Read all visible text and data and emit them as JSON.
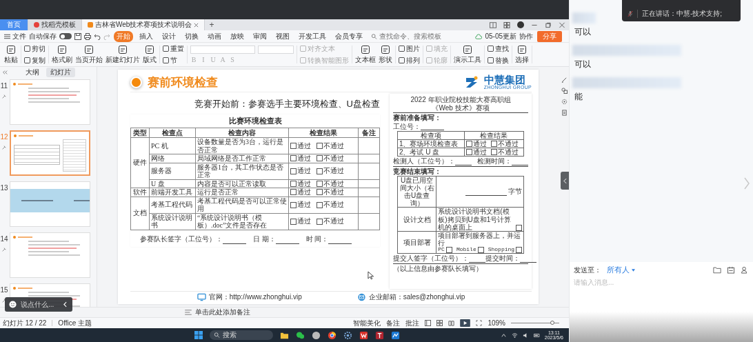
{
  "window": {
    "tabs": [
      {
        "label": "首页",
        "kind": "home",
        "selected": false
      },
      {
        "label": "找稻壳模板",
        "kind": "template",
        "selected": false
      },
      {
        "label": "吉林省Web技术赛项技术说明会",
        "kind": "document",
        "selected": true
      }
    ],
    "new_tab": "+"
  },
  "menu": {
    "file": "文件",
    "autosave": {
      "label": "自动保存",
      "on": false
    },
    "items": [
      {
        "label": "开始",
        "selected": true
      },
      {
        "label": "插入",
        "selected": false
      },
      {
        "label": "设计",
        "selected": false
      },
      {
        "label": "切换",
        "selected": false
      },
      {
        "label": "动画",
        "selected": false
      },
      {
        "label": "放映",
        "selected": false
      },
      {
        "label": "审阅",
        "selected": false
      },
      {
        "label": "视图",
        "selected": false
      },
      {
        "label": "开发工具",
        "selected": false
      },
      {
        "label": "会员专享",
        "selected": false
      }
    ],
    "search": {
      "placeholder": "查找命令、搜索模板"
    },
    "update": "05-05更新",
    "collab": "协作",
    "share": "分享"
  },
  "ribbon": {
    "groups": [
      {
        "kind": "large",
        "items": [
          {
            "label": "粘贴",
            "disabled": false
          }
        ]
      },
      {
        "kind": "stack",
        "items": [
          {
            "label": "剪切",
            "disabled": false
          },
          {
            "label": "复制",
            "disabled": false
          }
        ]
      },
      {
        "kind": "large",
        "items": [
          {
            "label": "格式刷",
            "disabled": false
          },
          {
            "label": "当页开始",
            "disabled": false
          },
          {
            "label": "新建幻灯片",
            "disabled": false
          },
          {
            "label": "版式",
            "disabled": false
          }
        ]
      },
      {
        "kind": "stack",
        "items": [
          {
            "label": "重置",
            "disabled": false
          },
          {
            "label": "节",
            "disabled": false
          }
        ]
      },
      {
        "kind": "font",
        "items": [
          {
            "label": "B",
            "disabled": true
          },
          {
            "label": "I",
            "disabled": true
          },
          {
            "label": "U",
            "disabled": true
          },
          {
            "label": "A",
            "disabled": true
          },
          {
            "label": "S",
            "disabled": true
          }
        ]
      },
      {
        "kind": "stack",
        "items": [
          {
            "label": "对齐文本",
            "disabled": true
          },
          {
            "label": "转换智能图形",
            "disabled": true
          }
        ]
      },
      {
        "kind": "large",
        "items": [
          {
            "label": "文本框",
            "disabled": false
          },
          {
            "label": "形状",
            "disabled": false
          }
        ]
      },
      {
        "kind": "stack",
        "items": [
          {
            "label": "图片",
            "disabled": false
          },
          {
            "label": "排列",
            "disabled": false
          }
        ]
      },
      {
        "kind": "stack",
        "items": [
          {
            "label": "填充",
            "disabled": true
          },
          {
            "label": "轮廓",
            "disabled": true
          }
        ]
      },
      {
        "kind": "large",
        "items": [
          {
            "label": "演示工具",
            "disabled": false
          }
        ]
      },
      {
        "kind": "stack",
        "items": [
          {
            "label": "查找",
            "disabled": false
          },
          {
            "label": "替换",
            "disabled": false
          }
        ]
      },
      {
        "kind": "large",
        "items": [
          {
            "label": "选择",
            "disabled": false
          }
        ]
      }
    ]
  },
  "slides_panel": {
    "tabs": [
      {
        "label": "大纲",
        "selected": false
      },
      {
        "label": "幻灯片",
        "selected": true
      }
    ],
    "thumbnails": [
      {
        "number": "11",
        "kind": "text",
        "selected": false,
        "animated": true
      },
      {
        "number": "12",
        "kind": "table",
        "selected": true,
        "animated": true
      },
      {
        "number": "13",
        "kind": "section",
        "selected": false,
        "animated": false
      },
      {
        "number": "14",
        "kind": "text",
        "selected": false,
        "animated": true
      },
      {
        "number": "15",
        "kind": "text",
        "selected": false,
        "animated": true
      }
    ]
  },
  "slide": {
    "title": "赛前环境检查",
    "logo": {
      "name": "中慧集团",
      "subtitle": "ZHONGHUI GROUP"
    },
    "subtitle": "竞赛开始前：参赛选手主要环境检查、U盘检查",
    "check_table": {
      "title": "比赛环境检查表",
      "columns": [
        "类型",
        "检查点",
        "检查内容",
        "检查结果",
        "备注"
      ],
      "groups": [
        {
          "type": "硬件",
          "rows": [
            {
              "point": "PC 机",
              "content": "设备数量是否为3台，运行是否正常",
              "results": [
                {
                  "label": "通过",
                  "checked": false
                },
                {
                  "label": "不通过",
                  "checked": false
                }
              ]
            },
            {
              "point": "网络",
              "content": "局域网络是否工作正常",
              "results": [
                {
                  "label": "通过",
                  "checked": false
                },
                {
                  "label": "不通过",
                  "checked": false
                }
              ]
            },
            {
              "point": "服务器",
              "content": "服务器1台，其工作状态是否正常",
              "results": [
                {
                  "label": "通过",
                  "checked": false
                },
                {
                  "label": "不通过",
                  "checked": false
                }
              ]
            },
            {
              "point": "U 盘",
              "content": "内容是否可以正常读取",
              "results": [
                {
                  "label": "通过",
                  "checked": false
                },
                {
                  "label": "不通过",
                  "checked": false
                }
              ]
            }
          ]
        },
        {
          "type": "软件",
          "rows": [
            {
              "point": "前端开发工具",
              "content": "运行是否正常",
              "results": [
                {
                  "label": "通过",
                  "checked": false
                },
                {
                  "label": "不通过",
                  "checked": false
                }
              ]
            }
          ]
        },
        {
          "type": "文档",
          "rows": [
            {
              "point": "考基工程代码",
              "content": "考基工程代码是否可以正常使用",
              "results": [
                {
                  "label": "通过",
                  "checked": false
                },
                {
                  "label": "不通过",
                  "checked": false
                }
              ]
            },
            {
              "point": "系统设计说明书",
              "content": "“系统设计说明书（模板）.doc”文件是否存在",
              "results": [
                {
                  "label": "通过",
                  "checked": false
                },
                {
                  "label": "不通过",
                  "checked": false
                }
              ]
            }
          ]
        }
      ],
      "signature": [
        "参赛队长签字（工位号）：",
        "日 期：",
        "时 间："
      ]
    },
    "entry_form": {
      "title_lines": [
        "2022 年职业院校技能大赛高职组",
        "《Web 技术》赛项"
      ],
      "section_1": "赛前准备填写：",
      "station_label": "工位号：",
      "check_columns": [
        "检查项",
        "检查结果"
      ],
      "check_rows": [
        {
          "item": "1、赛场环境检查表",
          "results": [
            {
              "label": "通过",
              "checked": false
            },
            {
              "label": "不通过",
              "checked": false
            }
          ]
        },
        {
          "item": "2、考试 U 盘",
          "results": [
            {
              "label": "通过",
              "checked": false
            },
            {
              "label": "不通过",
              "checked": false
            }
          ]
        }
      ],
      "checker_fields": [
        "检测人（工位号）：",
        "检测时间："
      ],
      "section_2": "竞赛结束填写：",
      "end_rows": [
        {
          "label": "U盘已用空间大小（右击U盘查询）",
          "kind": "size",
          "unit": "字节"
        },
        {
          "label": "设计文档",
          "kind": "check",
          "text": "系统设计说明书文档(模板)拷贝到U盘和1号计算机的桌面上",
          "checked": false
        },
        {
          "label": "项目部署",
          "kind": "options",
          "text": "项目部署到服务器上，并运行",
          "options": [
            {
              "label": "PC",
              "checked": false
            },
            {
              "label": "Mobile",
              "checked": false
            },
            {
              "label": "Shopping",
              "checked": false
            }
          ]
        }
      ],
      "submit_fields": [
        "提交人签字（工位号）：",
        "提交时间："
      ],
      "note": "（以上信息由参赛队长填写）"
    },
    "footer": [
      {
        "kind": "web",
        "text": "官网：http://www.zhonghui.vip"
      },
      {
        "kind": "mail",
        "text": "企业邮箱：sales@zhonghui.vip"
      }
    ]
  },
  "notes": {
    "placeholder": "单击此处添加备注"
  },
  "status_bar": {
    "slide_count": "幻灯片 12 / 22",
    "theme": "Office 主题",
    "beautify": "智能美化",
    "notes": "备注",
    "comments": "批注",
    "zoom": "109%",
    "zoom_slider": {
      "level": 0.85
    }
  },
  "comment_box": {
    "placeholder": "说点什么..."
  },
  "taskbar": {
    "search": "搜索",
    "time": "13:11",
    "date": "2023/5/6"
  },
  "chat": {
    "speaking": "正在讲话：中慧-技术支持;",
    "messages": [
      {
        "text": "可以"
      },
      {
        "text": "可以"
      },
      {
        "text": "能"
      }
    ],
    "send_to_label": "发送至：",
    "recipient": "所有人",
    "input": {
      "placeholder": "请输入消息..."
    }
  }
}
